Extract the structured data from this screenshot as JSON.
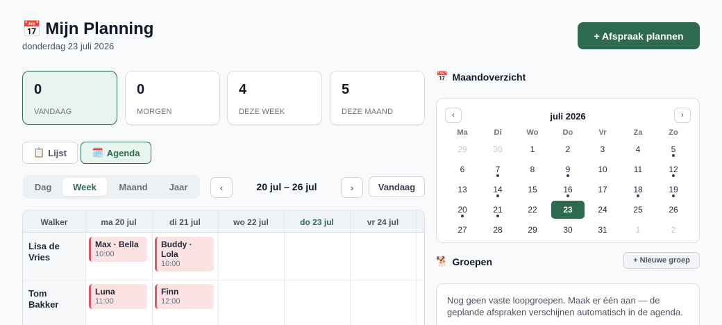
{
  "header": {
    "icon": "calendar-emoji",
    "title_icon_text": "📅",
    "title": "Mijn Planning",
    "subtitle": "donderdag 23 juli 2026",
    "cta": "+ Afspraak plannen"
  },
  "stats": [
    {
      "value": "0",
      "label": "VANDAAG",
      "active": true
    },
    {
      "value": "0",
      "label": "MORGEN",
      "active": false
    },
    {
      "value": "4",
      "label": "DEZE WEEK",
      "active": false
    },
    {
      "value": "5",
      "label": "DEZE MAAND",
      "active": false
    }
  ],
  "view_toggle": {
    "list_icon": "📋",
    "list_label": "Lijst",
    "agenda_icon": "🗓️",
    "agenda_label": "Agenda",
    "active": "Agenda"
  },
  "period_tabs": {
    "items": [
      "Dag",
      "Week",
      "Maand",
      "Jaar"
    ],
    "active": "Week"
  },
  "range_nav": {
    "prev": "‹",
    "label": "20 jul – 26 jul",
    "next": "›",
    "today": "Vandaag"
  },
  "week_grid": {
    "walker_header": "Walker",
    "days": [
      "ma 20 jul",
      "di 21 jul",
      "wo 22 jul",
      "do 23 jul",
      "vr 24 jul"
    ],
    "today_index": 3,
    "walkers": [
      {
        "name": "Lisa de Vries",
        "appointments": [
          {
            "day": 0,
            "title": "Max · Bella",
            "time": "10:00"
          },
          {
            "day": 1,
            "title": "Buddy · Lola",
            "time": "10:00"
          }
        ]
      },
      {
        "name": "Tom Bakker",
        "appointments": [
          {
            "day": 0,
            "title": "Luna",
            "time": "11:00"
          },
          {
            "day": 1,
            "title": "Finn",
            "time": "12:00"
          }
        ]
      }
    ],
    "accent_color": "#e05563"
  },
  "month_overview": {
    "section_icon": "📅",
    "section_title": "Maandoverzicht",
    "month": "juli 2026",
    "prev": "‹",
    "next": "›",
    "weekdays": [
      "Ma",
      "Di",
      "Wo",
      "Do",
      "Vr",
      "Za",
      "Zo"
    ],
    "weeks": [
      [
        {
          "d": "29",
          "m": true
        },
        {
          "d": "30",
          "m": true
        },
        {
          "d": "1"
        },
        {
          "d": "2"
        },
        {
          "d": "3"
        },
        {
          "d": "4"
        },
        {
          "d": "5",
          "dot": true
        }
      ],
      [
        {
          "d": "6"
        },
        {
          "d": "7",
          "dot": true
        },
        {
          "d": "8"
        },
        {
          "d": "9",
          "dot": true
        },
        {
          "d": "10"
        },
        {
          "d": "11"
        },
        {
          "d": "12",
          "dot": true
        }
      ],
      [
        {
          "d": "13"
        },
        {
          "d": "14",
          "dot": true
        },
        {
          "d": "15"
        },
        {
          "d": "16",
          "dot": true
        },
        {
          "d": "17"
        },
        {
          "d": "18",
          "dot": true
        },
        {
          "d": "19",
          "dot": true
        }
      ],
      [
        {
          "d": "20",
          "dot": true
        },
        {
          "d": "21",
          "dot": true
        },
        {
          "d": "22"
        },
        {
          "d": "23",
          "sel": true
        },
        {
          "d": "24"
        },
        {
          "d": "25"
        },
        {
          "d": "26"
        }
      ],
      [
        {
          "d": "27"
        },
        {
          "d": "28"
        },
        {
          "d": "29"
        },
        {
          "d": "30"
        },
        {
          "d": "31"
        },
        {
          "d": "1",
          "m": true
        },
        {
          "d": "2",
          "m": true
        }
      ]
    ],
    "selected_color": "#2d6a4f"
  },
  "groups": {
    "section_icon": "🐕",
    "section_title": "Groepen",
    "new_button": "+ Nieuwe groep",
    "empty_text": "Nog geen vaste loopgroepen. Maak er één aan — de geplande afspraken verschijnen automatisch in de agenda."
  },
  "colors": {
    "brand": "#2d6a4f",
    "brand_light": "#e8f5ee",
    "background": "#f8fafc"
  }
}
